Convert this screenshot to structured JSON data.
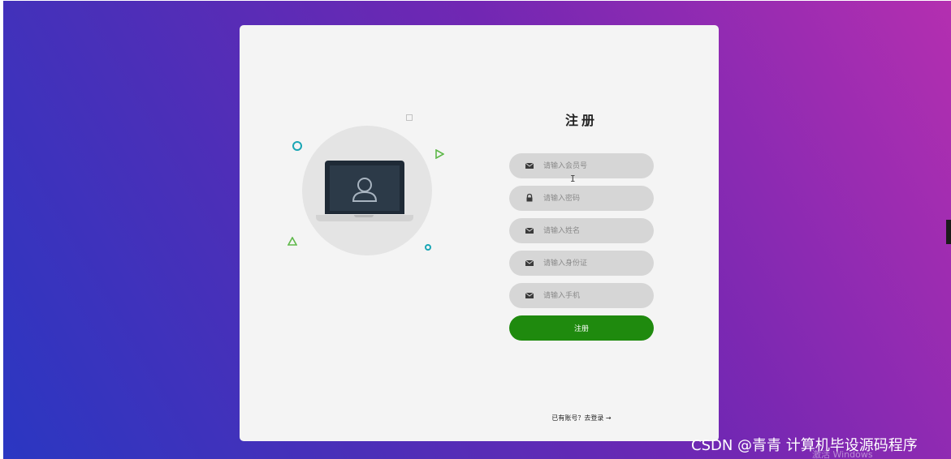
{
  "form": {
    "title": "注册",
    "fields": [
      {
        "placeholder": "请输入会员号",
        "value": "",
        "icon": "envelope-icon"
      },
      {
        "placeholder": "请输入密码",
        "value": "",
        "icon": "lock-icon"
      },
      {
        "placeholder": "请输入姓名",
        "value": "",
        "icon": "envelope-icon"
      },
      {
        "placeholder": "请输入身份证",
        "value": "",
        "icon": "envelope-icon"
      },
      {
        "placeholder": "请输入手机",
        "value": "",
        "icon": "envelope-icon"
      }
    ],
    "submit_label": "注册",
    "login_link": "已有账号？去登录 →"
  },
  "watermark": {
    "text": "CSDN @青青  计算机毕设源码程序",
    "windows_activation": "激活 Windows"
  },
  "colors": {
    "card_bg": "#f4f4f4",
    "field_bg": "#d6d6d6",
    "button_green": "#1f8a0e",
    "accent_teal": "#1aa6b5",
    "accent_lime": "#5fb84a"
  }
}
